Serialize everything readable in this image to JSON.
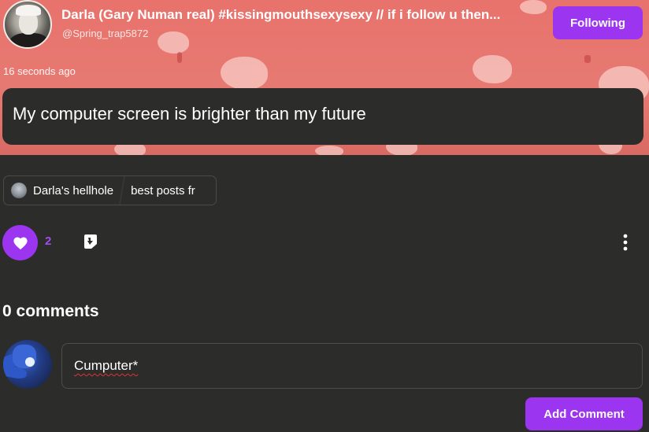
{
  "post": {
    "author_name": "Darla (Gary Numan real) #kissingmouthsexysexy // if i follow u then...",
    "author_handle": "@Spring_trap5872",
    "follow_label": "Following",
    "timestamp": "16 seconds ago",
    "text": "My computer screen is brighter than my future",
    "community": {
      "name": "Darla's hellhole",
      "collection": "best posts fr"
    },
    "like_count": "2"
  },
  "comments": {
    "title": "0 comments",
    "input_value": "Cumputer*",
    "add_label": "Add Comment"
  },
  "icons": {
    "like": "heart-icon",
    "reply": "reply-icon",
    "more": "more-vertical-icon"
  },
  "colors": {
    "accent": "#9b35f0",
    "banner": "#e8726c",
    "background": "#2c2d2a"
  }
}
